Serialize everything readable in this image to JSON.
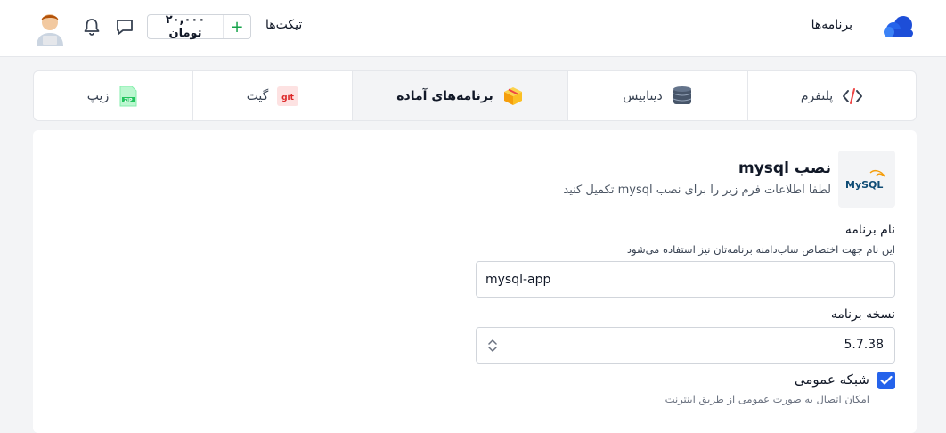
{
  "header": {
    "apps_label": "برنامه‌ها",
    "tickets_label": "تیکت‌ها",
    "wallet_amount": "۲۰,۰۰۰ تومان",
    "wallet_add": "+",
    "brand_color": "#2563eb"
  },
  "tabs": [
    {
      "label": "پلتفرم",
      "icon": "code-icon",
      "active": false
    },
    {
      "label": "دیتابیس",
      "icon": "database-icon",
      "active": false
    },
    {
      "label": "برنامه‌های آماده",
      "icon": "package-icon",
      "active": true
    },
    {
      "label": "گیت",
      "icon": "git-icon",
      "active": false
    },
    {
      "label": "زیپ",
      "icon": "zip-icon",
      "active": false
    }
  ],
  "app": {
    "title": "نصب mysql",
    "description": "لطفا اطلاعات فرم زیر را برای نصب mysql تکمیل کنید",
    "logo_text": "MySQL"
  },
  "form": {
    "name_label": "نام برنامه",
    "name_hint": "این نام جهت اختصاص ساب‌دامنه برنامه‌تان نیز استفاده می‌شود",
    "name_value": "mysql-app",
    "version_label": "نسخه برنامه",
    "version_value": "5.7.38",
    "public_network_label": "شبکه عمومی",
    "public_network_hint": "امکان اتصال به صورت عمومی از طریق اینترنت",
    "public_network_checked": true
  }
}
